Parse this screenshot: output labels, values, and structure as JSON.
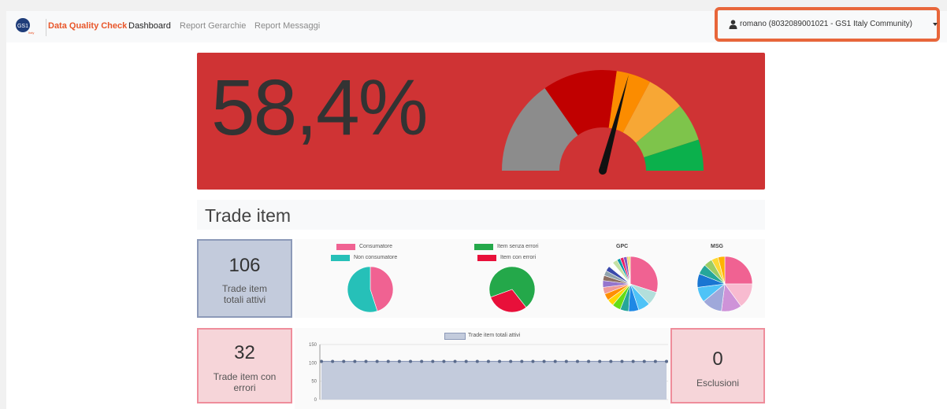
{
  "navbar": {
    "brand": "Data Quality Check",
    "links": [
      {
        "label": "Dashboard",
        "active": true
      },
      {
        "label": "Report Gerarchie",
        "active": false
      },
      {
        "label": "Report Messaggi",
        "active": false
      }
    ],
    "user": "romano (8032089001021 - GS1 Italy Community)"
  },
  "logo": {
    "text": "GS1",
    "sub": "Italy"
  },
  "hero": {
    "score": "58,4%",
    "gauge_value": 58.4,
    "gauge_colors": [
      "#8c8c8c",
      "#c00000",
      "#fb8c00",
      "#f7a735",
      "#7ec44b",
      "#0bb04c"
    ]
  },
  "section": {
    "title": "Trade item"
  },
  "cards": {
    "active": {
      "value": "106",
      "label": "Trade item totali attivi"
    },
    "errors": {
      "value": "32",
      "label": "Trade item con errori"
    },
    "exclusions": {
      "value": "0",
      "label": "Esclusioni"
    }
  },
  "chart_data": [
    {
      "type": "pie",
      "legend": [
        "Consumatore",
        "Non consumatore"
      ],
      "colors": [
        "#f06292",
        "#26c0b8"
      ],
      "values": [
        45,
        55
      ]
    },
    {
      "type": "pie",
      "legend": [
        "Item senza errori",
        "Item con errori"
      ],
      "colors": [
        "#24a84a",
        "#e8103a"
      ],
      "values": [
        70,
        30
      ]
    },
    {
      "type": "pie",
      "title": "GPC",
      "colors": [
        "#f06292",
        "#b2dfdb",
        "#4fc3f7",
        "#1e88e5",
        "#26a69a",
        "#64dd17",
        "#ffd600",
        "#ff8f00",
        "#ef9a9a",
        "#9575cd",
        "#8d6e63",
        "#90a4ae",
        "#3949ab",
        "#ffffff",
        "#c5e1a5",
        "#0097a7",
        "#e91e63",
        "#7e57c2",
        "#ffb74d",
        "#d4e157"
      ],
      "values": [
        30,
        8,
        7,
        6,
        5,
        5,
        4,
        4,
        4,
        4,
        3,
        3,
        3,
        3,
        3,
        2,
        2,
        2,
        1,
        1
      ]
    },
    {
      "type": "pie",
      "title": "MSG",
      "colors": [
        "#f06292",
        "#f8bbd0",
        "#ce93d8",
        "#9fa8da",
        "#4fc3f7",
        "#1976d2",
        "#26a69a",
        "#9ccc65",
        "#fdd835",
        "#ffb300"
      ],
      "values": [
        25,
        15,
        12,
        12,
        9,
        8,
        6,
        5,
        4,
        4
      ]
    },
    {
      "type": "area",
      "legend": [
        "Trade item totali attivi"
      ],
      "ylim": [
        0,
        150
      ],
      "yticks": [
        "150",
        "100",
        "50",
        "0"
      ],
      "values": [
        104,
        104,
        104,
        104,
        104,
        104,
        104,
        104,
        104,
        104,
        104,
        104,
        104,
        104,
        104,
        104,
        104,
        104,
        104,
        104,
        104,
        104,
        104,
        104,
        104,
        104,
        104,
        104,
        104,
        104,
        104,
        104
      ]
    }
  ]
}
